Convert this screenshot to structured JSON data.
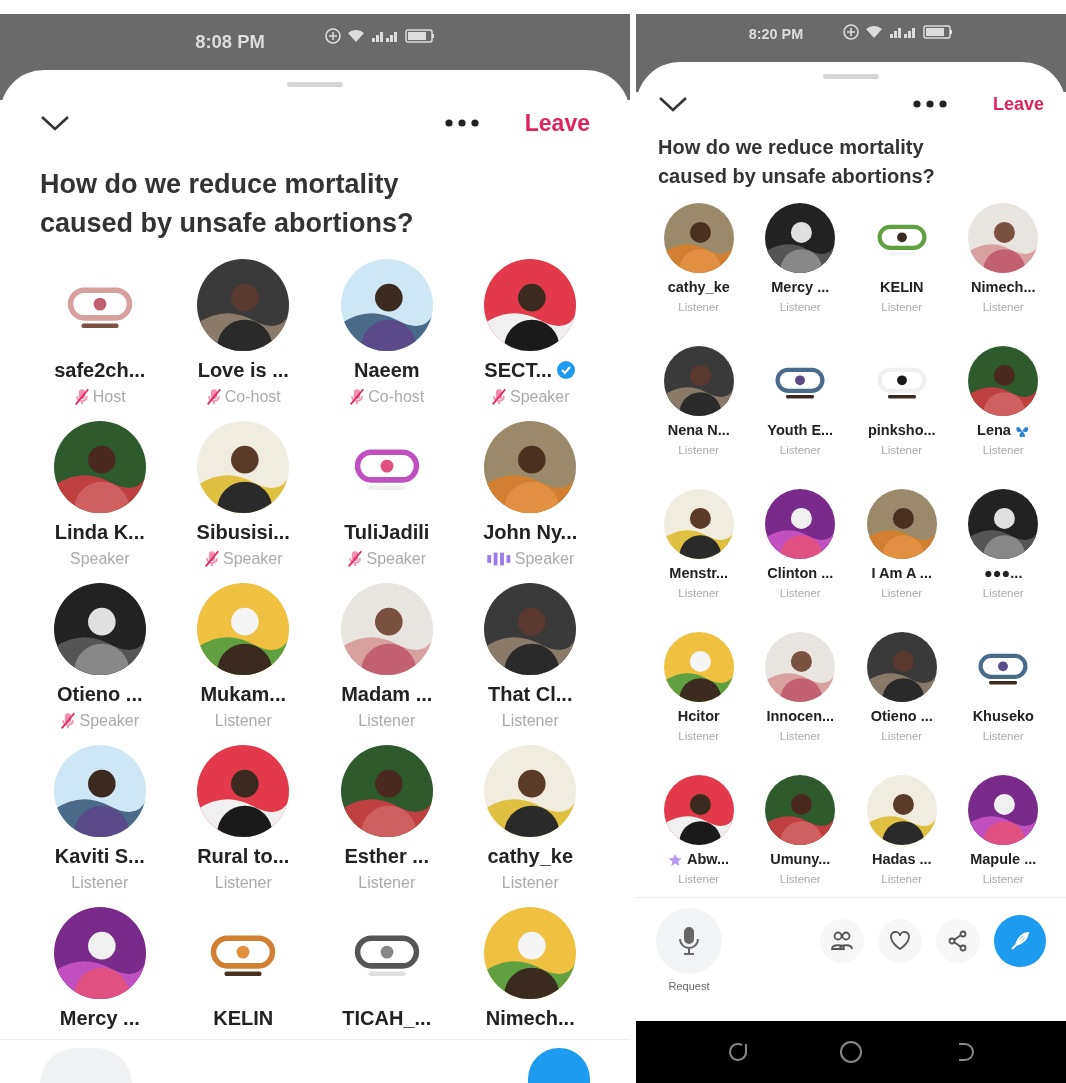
{
  "screens": [
    {
      "status_bar": {
        "time": "8:08 PM"
      },
      "header": {
        "leave": "Leave"
      },
      "title": "How do we reduce mortality caused by unsafe abortions?",
      "participants": [
        {
          "name": "safe2ch...",
          "role": "Host",
          "muted": true,
          "speaking": false,
          "kind": "logo"
        },
        {
          "name": "Love is ...",
          "role": "Co-host",
          "muted": true,
          "speaking": false
        },
        {
          "name": "Naeem",
          "role": "Co-host",
          "muted": true,
          "speaking": false
        },
        {
          "name": "SECT...",
          "verified": true,
          "role": "Speaker",
          "muted": true,
          "speaking": false
        },
        {
          "name": "Linda K...",
          "role": "Speaker",
          "muted": false,
          "speaking": false
        },
        {
          "name": "Sibusisi...",
          "role": "Speaker",
          "muted": true,
          "speaking": false
        },
        {
          "name": "TuliJadili",
          "role": "Speaker",
          "muted": true,
          "speaking": false,
          "kind": "logo"
        },
        {
          "name": "John Ny...",
          "role": "Speaker",
          "muted": false,
          "speaking": true
        },
        {
          "name": "Otieno ...",
          "role": "Speaker",
          "muted": true,
          "speaking": false
        },
        {
          "name": "Mukam...",
          "role": "Listener"
        },
        {
          "name": "Madam ...",
          "role": "Listener"
        },
        {
          "name": "That Cl...",
          "role": "Listener"
        },
        {
          "name": "Kaviti S...",
          "role": "Listener"
        },
        {
          "name": "Rural to...",
          "role": "Listener"
        },
        {
          "name": "Esther ...",
          "role": "Listener"
        },
        {
          "name": "cathy_ke",
          "role": "Listener"
        },
        {
          "name": "Mercy ..."
        },
        {
          "name": "KELIN",
          "kind": "logo"
        },
        {
          "name": "TICAH_...",
          "kind": "logo"
        },
        {
          "name": "Nimech..."
        }
      ],
      "bottom_bar_cut": true
    },
    {
      "status_bar": {
        "time": "8:20 PM"
      },
      "header": {
        "leave": "Leave"
      },
      "title": "How do we reduce mortality caused by unsafe abortions?",
      "participants": [
        {
          "name": "cathy_ke",
          "role": "Listener"
        },
        {
          "name": "Mercy ...",
          "role": "Listener"
        },
        {
          "name": "KELIN",
          "role": "Listener",
          "kind": "logo"
        },
        {
          "name": "Nimech...",
          "role": "Listener"
        },
        {
          "name": "Nena N...",
          "role": "Listener"
        },
        {
          "name": "Youth E...",
          "role": "Listener",
          "kind": "logo"
        },
        {
          "name": "pinksho...",
          "role": "Listener",
          "kind": "logo"
        },
        {
          "name": "Lena",
          "butterfly_badge": true,
          "role": "Listener"
        },
        {
          "name": "Menstr...",
          "role": "Listener"
        },
        {
          "name": "Clinton ...",
          "role": "Listener"
        },
        {
          "name": "I Am A ...",
          "role": "Listener"
        },
        {
          "name": "●●●...",
          "role": "Listener"
        },
        {
          "name": "Hcitor",
          "role": "Listener"
        },
        {
          "name": "Innocen...",
          "role": "Listener"
        },
        {
          "name": "Otieno ...",
          "role": "Listener"
        },
        {
          "name": "Khuseko",
          "role": "Listener",
          "kind": "logo"
        },
        {
          "name": "Abw...",
          "star_badge": true,
          "role": "Listener"
        },
        {
          "name": "Umuny...",
          "role": "Listener"
        },
        {
          "name": "Hadas ...",
          "role": "Listener"
        },
        {
          "name": "Mapule ...",
          "role": "Listener"
        }
      ],
      "bottom_bar": {
        "request_label": "Request"
      },
      "nav_bar": true
    }
  ]
}
